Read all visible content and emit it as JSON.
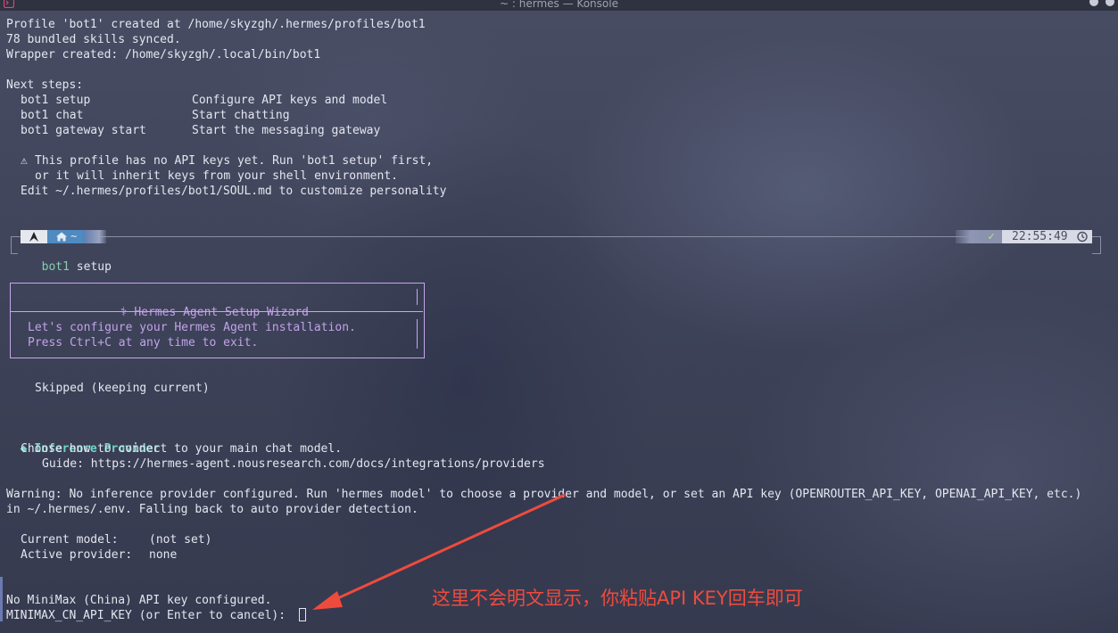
{
  "window": {
    "title": "~ : hermes — Konsole",
    "icon": "terminal-app-icon",
    "buttons": [
      "minimize-icon",
      "maximize-icon",
      "close-icon"
    ]
  },
  "output": {
    "profile_created": "Profile 'bot1' created at /home/skyzgh/.hermes/profiles/bot1",
    "skills_synced": "78 bundled skills synced.",
    "wrapper_created": "Wrapper created: /home/skyzgh/.local/bin/bot1",
    "next_steps_heading": "Next steps:",
    "steps": [
      {
        "cmd": "bot1 setup",
        "desc": "Configure API keys and model"
      },
      {
        "cmd": "bot1 chat",
        "desc": "Start chatting"
      },
      {
        "cmd": "bot1 gateway start",
        "desc": "Start the messaging gateway"
      }
    ],
    "warning_icon": "⚠",
    "warning_line1": "This profile has no API keys yet. Run 'bot1 setup' first,",
    "warning_line2": "or it will inherit keys from your shell environment.",
    "edit_line": "Edit ~/.hermes/profiles/bot1/SOUL.md to customize personality"
  },
  "prompt": {
    "os_icon": "arch-linux-icon",
    "home_icon": "home-icon",
    "dir": "~",
    "status_icon": "✓",
    "time": "22:55:49",
    "clock_icon": "clock-icon",
    "command_name": "bot1",
    "command_arg": "setup"
  },
  "wizard": {
    "title_glyph": "⚕",
    "title": "Hermes Agent Setup Wizard",
    "intro_line1": "Let's configure your Hermes Agent installation.",
    "intro_line2": "Press Ctrl+C at any time to exit.",
    "skipped": "Skipped (keeping current)",
    "section_bullet": "◆",
    "section_title": "Inference Provider",
    "section_desc": "Choose how to connect to your main chat model.",
    "guide": "Guide: https://hermes-agent.nousresearch.com/docs/integrations/providers",
    "warning_line1": "Warning: No inference provider configured. Run 'hermes model' to choose a provider and model, or set an API key (OPENROUTER_API_KEY, OPENAI_API_KEY, etc.)",
    "warning_line2": "in ~/.hermes/.env. Falling back to auto provider detection.",
    "current_model_label": "Current model:",
    "current_model_value": "(not set)",
    "active_provider_label": "Active provider:",
    "active_provider_value": "none",
    "no_key": "No MiniMax (China) API key configured.",
    "key_prompt": "MINIMAX_CN_API_KEY (or Enter to cancel):"
  },
  "annotation": {
    "text": "这里不会明文显示，你粘贴API KEY回车即可",
    "color": "#ef4b3c"
  }
}
